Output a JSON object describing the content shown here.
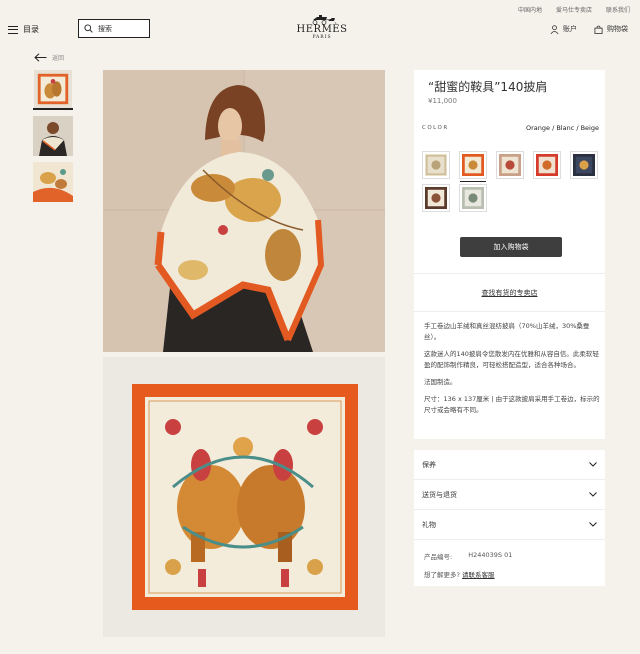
{
  "utility": {
    "region": "中国内地",
    "store_link": "爱马仕专卖店",
    "contact": "联系我们"
  },
  "header": {
    "menu_label": "目录",
    "search_label": "搜索",
    "brand": "HERMÈS",
    "city": "PARIS",
    "account_label": "账户",
    "bag_label": "购物袋"
  },
  "nav": {
    "back_label": "返回"
  },
  "product": {
    "title": "“甜蜜的鞍具”140披肩",
    "price": "¥11,000",
    "color_label": "COLOR",
    "color_value": "Orange / Blanc / Beige",
    "add_to_bag": "加入购物袋",
    "find_store": "查找有货的专卖店",
    "description": [
      "手工卷边山羊绒和真丝混纺披肩（70%山羊绒，30%桑蚕丝）。",
      "这款迷人的140披肩令您散发内在优雅和从容自信。此柔软轻盈的配饰制作精良，可轻松搭配造型，适合各种场合。",
      "法国制造。",
      "尺寸：136 x 137厘米 | 由于这款披肩采用手工卷边，标示的尺寸或会略有不同。"
    ],
    "accordion": [
      "保养",
      "送货与退货",
      "礼物"
    ],
    "code_label": "产品编号:",
    "code_value": "H244039S 01",
    "help_text": "想了解更多?",
    "help_link": "请联系客服"
  },
  "colors": {
    "accent_orange": "#e25a22",
    "button_dark": "#3e3e3e",
    "background": "#f5f2ec"
  },
  "icons": [
    "hamburger-icon",
    "search-icon",
    "carriage-logo-icon",
    "account-icon",
    "bag-icon",
    "back-arrow-icon",
    "chevron-down-icon"
  ]
}
